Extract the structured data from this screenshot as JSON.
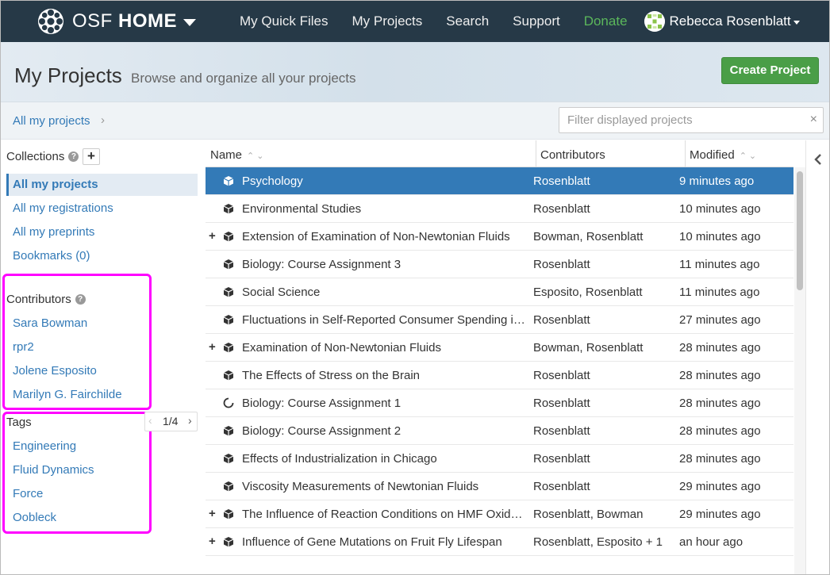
{
  "navbar": {
    "brand_light": "OSF",
    "brand_bold": "HOME",
    "links": [
      "My Quick Files",
      "My Projects",
      "Search",
      "Support",
      "Donate"
    ],
    "user": "Rebecca Rosenblatt"
  },
  "header": {
    "title": "My Projects",
    "subtitle": "Browse and organize all your projects",
    "create_button": "Create Project"
  },
  "breadcrumb": {
    "item": "All my projects",
    "chevron": "›"
  },
  "filter": {
    "placeholder": "Filter displayed projects",
    "clear": "×"
  },
  "sidebar": {
    "collections_label": "Collections",
    "add_symbol": "+",
    "collections": [
      "All my projects",
      "All my registrations",
      "All my preprints",
      "Bookmarks (0)"
    ],
    "contributors_label": "Contributors",
    "contributors": [
      "Sara Bowman",
      "rpr2",
      "Jolene Esposito",
      "Marilyn G. Fairchilde"
    ],
    "tags_label": "Tags",
    "tags_pager": "1/4",
    "tags_prev": "‹",
    "tags_next": "›",
    "tags": [
      "Engineering",
      "Fluid Dynamics",
      "Force",
      "Oobleck"
    ],
    "help_symbol": "?"
  },
  "table": {
    "headers": {
      "name": "Name",
      "contributors": "Contributors",
      "modified": "Modified",
      "sort_arrows": "⌃⌄"
    },
    "rows": [
      {
        "name": "Psychology",
        "contributors": "Rosenblatt",
        "modified": "9 minutes ago",
        "expand": "",
        "icon": "cube"
      },
      {
        "name": "Environmental Studies",
        "contributors": "Rosenblatt",
        "modified": "10 minutes ago",
        "expand": "",
        "icon": "cube"
      },
      {
        "name": "Extension of Examination of Non-Newtonian Fluids",
        "contributors": "Bowman, Rosenblatt",
        "modified": "10 minutes ago",
        "expand": "+",
        "icon": "cube"
      },
      {
        "name": "Biology: Course Assignment 3",
        "contributors": "Rosenblatt",
        "modified": "11 minutes ago",
        "expand": "",
        "icon": "cube"
      },
      {
        "name": "Social Science",
        "contributors": "Esposito, Rosenblatt",
        "modified": "11 minutes ago",
        "expand": "",
        "icon": "cube"
      },
      {
        "name": "Fluctuations in Self-Reported Consumer Spending in ...",
        "contributors": "Rosenblatt",
        "modified": "27 minutes ago",
        "expand": "",
        "icon": "cube"
      },
      {
        "name": "Examination of Non-Newtonian Fluids",
        "contributors": "Bowman, Rosenblatt",
        "modified": "28 minutes ago",
        "expand": "+",
        "icon": "cube"
      },
      {
        "name": "The Effects of Stress on the Brain",
        "contributors": "Rosenblatt",
        "modified": "28 minutes ago",
        "expand": "",
        "icon": "cube"
      },
      {
        "name": "Biology: Course Assignment 1",
        "contributors": "Rosenblatt",
        "modified": "28 minutes ago",
        "expand": "",
        "icon": "spinner"
      },
      {
        "name": "Biology: Course Assignment 2",
        "contributors": "Rosenblatt",
        "modified": "28 minutes ago",
        "expand": "",
        "icon": "cube"
      },
      {
        "name": "Effects of Industrialization in Chicago",
        "contributors": "Rosenblatt",
        "modified": "28 minutes ago",
        "expand": "",
        "icon": "cube"
      },
      {
        "name": "Viscosity Measurements of Newtonian Fluids",
        "contributors": "Rosenblatt",
        "modified": "29 minutes ago",
        "expand": "",
        "icon": "cube"
      },
      {
        "name": "The Influence of Reaction Conditions on HMF Oxidati...",
        "contributors": "Rosenblatt, Bowman",
        "modified": "29 minutes ago",
        "expand": "+",
        "icon": "cube"
      },
      {
        "name": "Influence of Gene Mutations on Fruit Fly Lifespan",
        "contributors": "Rosenblatt, Esposito + 1",
        "modified": "an hour ago",
        "expand": "+",
        "icon": "cube"
      }
    ],
    "selected_index": 0
  },
  "colors": {
    "navbar": "#263947",
    "accent": "#337ab7",
    "create_button": "#4a9e47",
    "donate": "#5bb75b",
    "highlight_box": "#ff00ff"
  }
}
